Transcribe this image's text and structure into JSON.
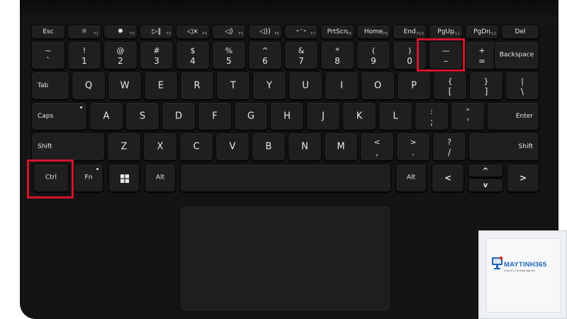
{
  "highlight_color": "#d4142b",
  "keyboard": {
    "row_fn": {
      "esc": "Esc",
      "f1": {
        "icon": "brightness-low-icon",
        "sub": "F1"
      },
      "f2": {
        "icon": "brightness-high-icon",
        "sub": "F2"
      },
      "f3": {
        "icon": "play-pause-icon",
        "sub": "F3"
      },
      "f4": {
        "icon": "mute-icon",
        "sub": "F4"
      },
      "f5": {
        "icon": "volume-down-icon",
        "sub": "F5"
      },
      "f6": {
        "icon": "volume-up-icon",
        "sub": "F6"
      },
      "f7": {
        "icon": "backlight-icon",
        "sub": "F7"
      },
      "f8": {
        "label": "PrtScn",
        "sub": "F8"
      },
      "f9": {
        "label": "Home",
        "sub": "F9"
      },
      "f10": {
        "label": "End",
        "sub": "F10"
      },
      "f11": {
        "label": "PgUp",
        "sub": "F11"
      },
      "f12": {
        "label": "PgDn",
        "sub": "F12"
      },
      "del": "Del"
    },
    "row_num": [
      {
        "u": "~",
        "l": "`"
      },
      {
        "u": "!",
        "l": "1"
      },
      {
        "u": "@",
        "l": "2"
      },
      {
        "u": "#",
        "l": "3"
      },
      {
        "u": "$",
        "l": "4"
      },
      {
        "u": "%",
        "l": "5"
      },
      {
        "u": "^",
        "l": "6"
      },
      {
        "u": "&",
        "l": "7"
      },
      {
        "u": "*",
        "l": "8"
      },
      {
        "u": "(",
        "l": "9"
      },
      {
        "u": ")",
        "l": "0"
      },
      {
        "u": "—",
        "l": "–"
      },
      {
        "u": "+",
        "l": "="
      }
    ],
    "backspace": "Backspace",
    "tab": "Tab",
    "row_q": [
      "Q",
      "W",
      "E",
      "R",
      "T",
      "Y",
      "U",
      "I",
      "O",
      "P"
    ],
    "brackets": [
      {
        "u": "{",
        "l": "["
      },
      {
        "u": "}",
        "l": "]"
      },
      {
        "u": "|",
        "l": "\\"
      }
    ],
    "caps": "Caps",
    "row_a": [
      "A",
      "S",
      "D",
      "F",
      "G",
      "H",
      "J",
      "K",
      "L"
    ],
    "semis": [
      {
        "u": ":",
        "l": ";"
      },
      {
        "u": "\"",
        "l": "'"
      }
    ],
    "enter": "Enter",
    "shift_left": "Shift",
    "row_z": [
      "Z",
      "X",
      "C",
      "V",
      "B",
      "N",
      "M"
    ],
    "punct": [
      {
        "u": "<",
        "l": ","
      },
      {
        "u": ">",
        "l": "."
      },
      {
        "u": "?",
        "l": "/"
      }
    ],
    "shift_right": "Shift",
    "ctrl": "Ctrl",
    "fn": "Fn",
    "win_icon": "windows-logo-icon",
    "alt_left": "Alt",
    "alt_right": "Alt",
    "arrows": {
      "left": "<",
      "up": "^",
      "down": "v",
      "right": ">"
    }
  },
  "watermark": {
    "brand": "MAYTINH365",
    "tagline": "Chia sẻ & Thủ thuật Máy tính",
    "logo_icon": "computer-logo-icon"
  }
}
